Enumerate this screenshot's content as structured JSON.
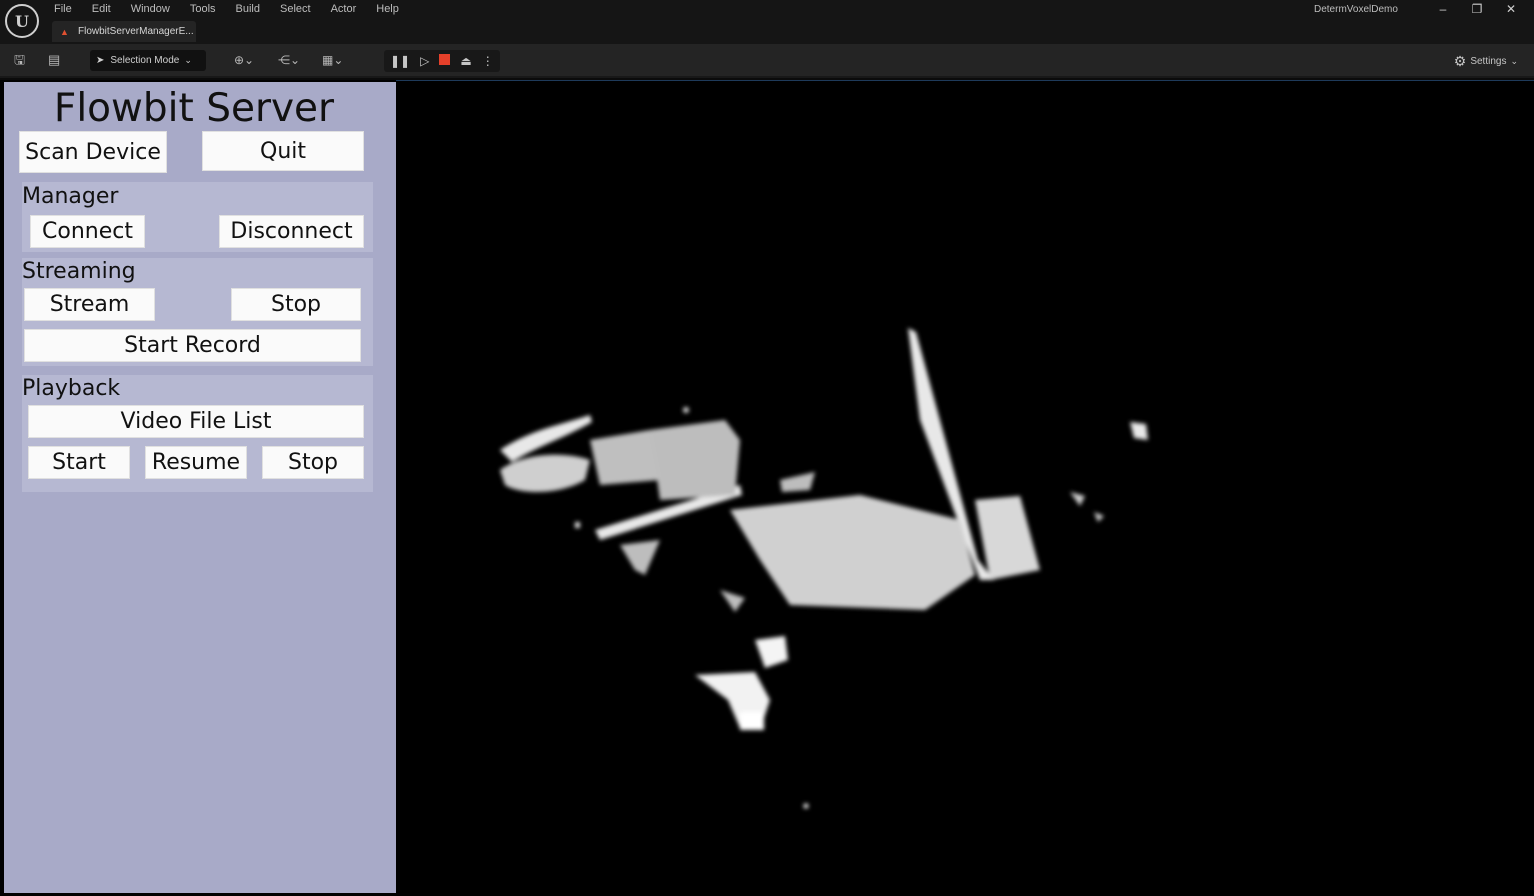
{
  "menu": [
    "File",
    "Edit",
    "Window",
    "Tools",
    "Build",
    "Select",
    "Actor",
    "Help"
  ],
  "tab_label": "FlowbitServerManagerE...",
  "project_name": "DetermVoxelDemo",
  "toolbar": {
    "selection_mode": "Selection Mode",
    "settings": "Settings"
  },
  "panel": {
    "title": "Flowbit Server",
    "scan_device": "Scan Device",
    "quit": "Quit",
    "manager": {
      "label": "Manager",
      "connect": "Connect",
      "disconnect": "Disconnect"
    },
    "streaming": {
      "label": "Streaming",
      "stream": "Stream",
      "stop": "Stop",
      "start_record": "Start Record"
    },
    "playback": {
      "label": "Playback",
      "video_file_list": "Video File List",
      "start": "Start",
      "resume": "Resume",
      "stop": "Stop"
    }
  },
  "icons": {
    "engine_logo": "unreal-logo-icon",
    "save": "save-icon",
    "browse": "content-browser-icon",
    "add": "add-actor-icon",
    "blueprint": "blueprint-icon",
    "cinematics": "cinematics-icon",
    "pause": "pause-icon",
    "step": "step-icon",
    "stop": "stop-icon",
    "eject": "eject-icon",
    "gear": "gear-icon"
  },
  "colors": {
    "panel_bg": "#a8aac8",
    "section_bg": "#b6b8d2",
    "stop_red": "#e5402a",
    "viewport_bg": "#000000"
  }
}
